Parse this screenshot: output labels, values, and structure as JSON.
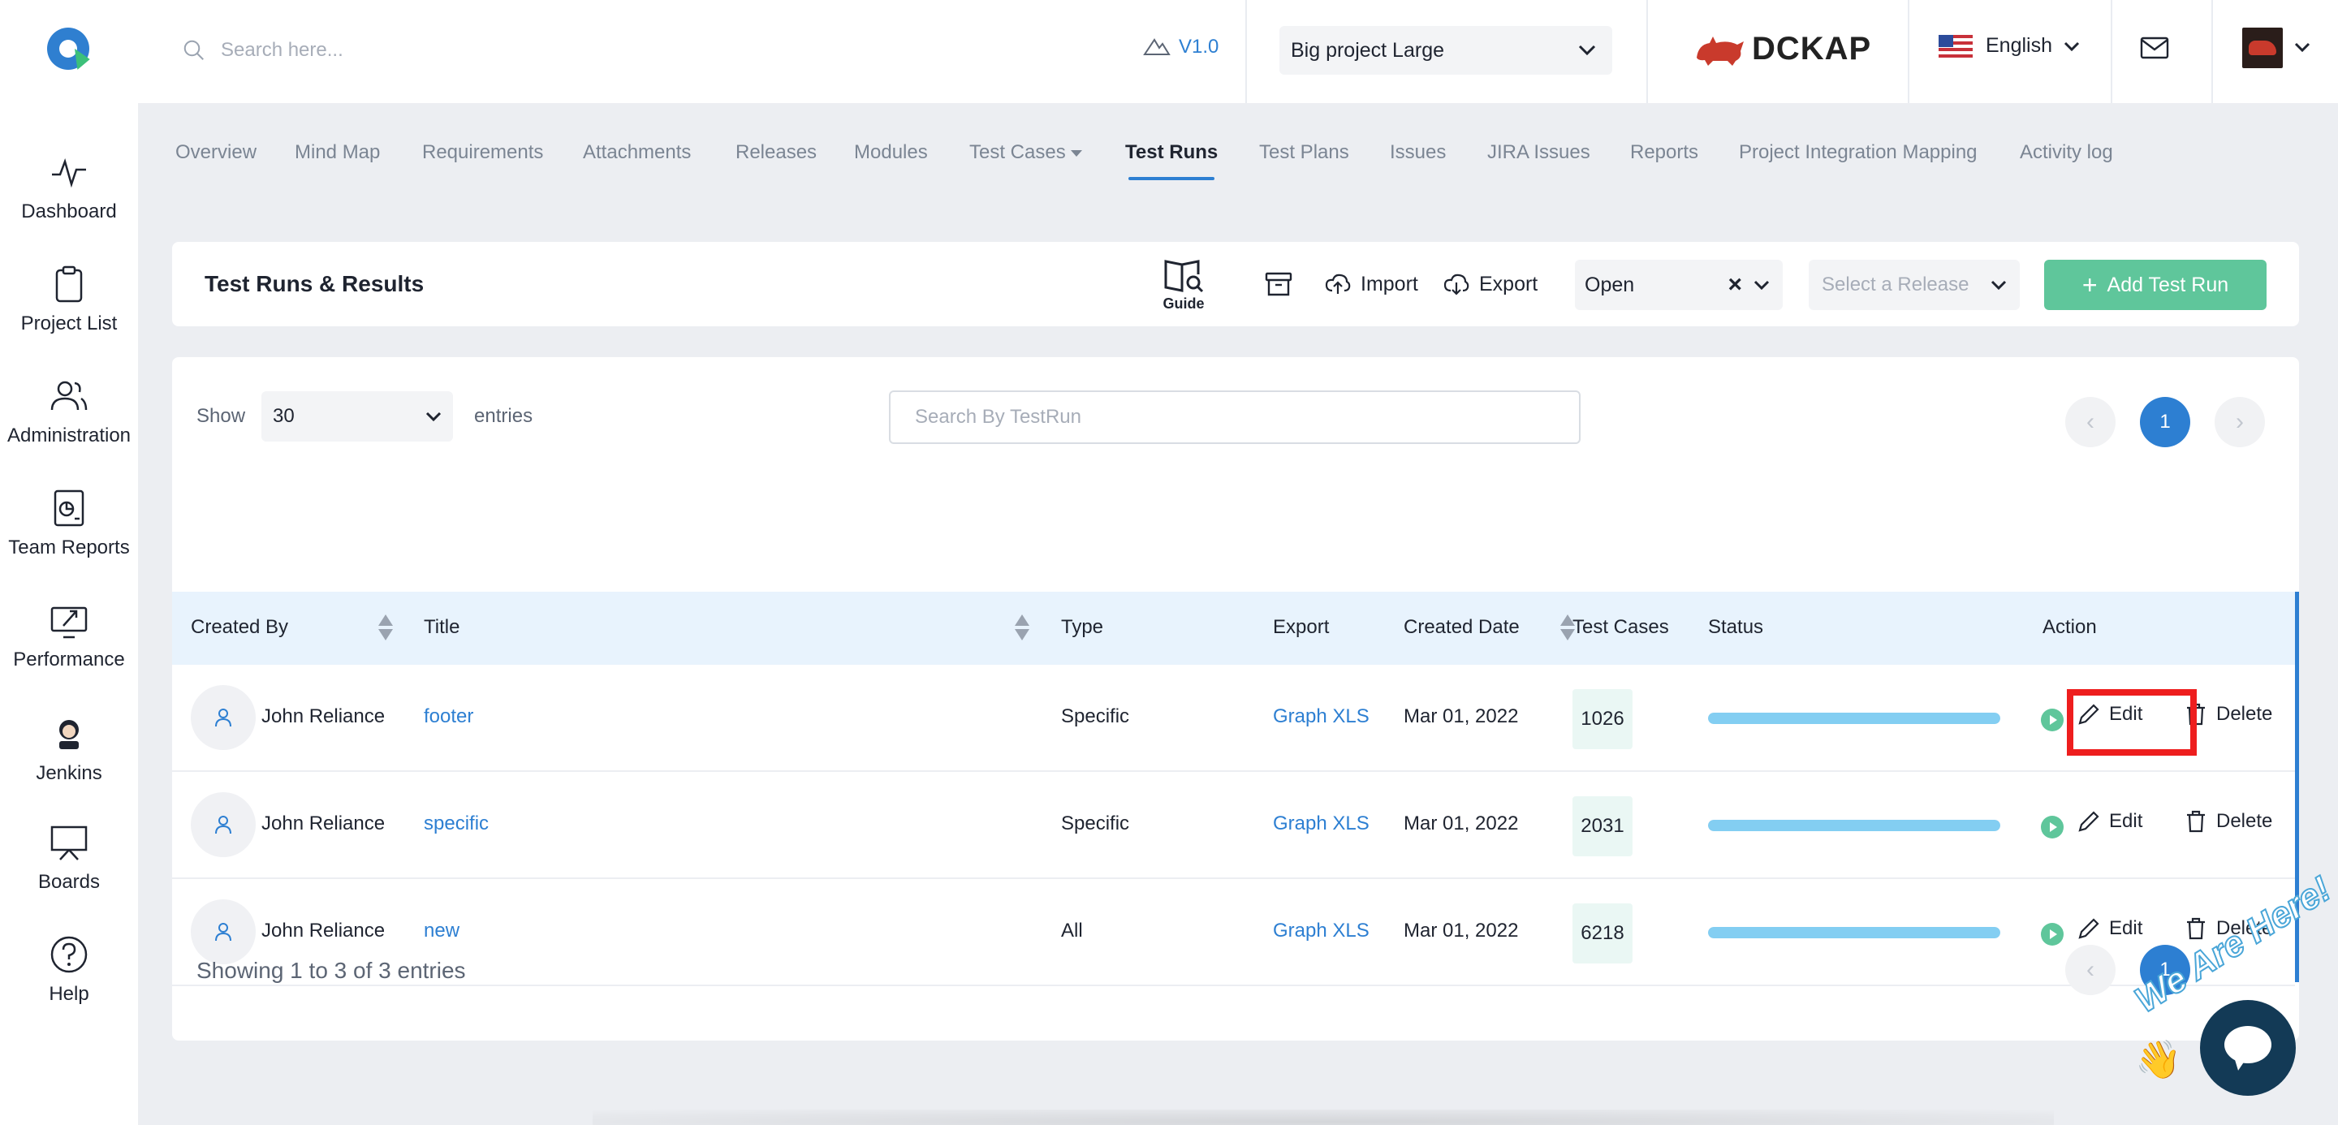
{
  "header": {
    "search_placeholder": "Search here...",
    "version": "V1.0",
    "project": "Big project Large",
    "brand": "DCKAP",
    "language": "English"
  },
  "sidebar": {
    "items": [
      {
        "label": "Dashboard",
        "icon": "pulse-icon"
      },
      {
        "label": "Project List",
        "icon": "clipboard-icon"
      },
      {
        "label": "Administration",
        "icon": "users-icon"
      },
      {
        "label": "Team Reports",
        "icon": "report-icon"
      },
      {
        "label": "Performance",
        "icon": "rocket-icon"
      },
      {
        "label": "Jenkins",
        "icon": "jenkins-icon"
      },
      {
        "label": "Boards",
        "icon": "board-icon"
      },
      {
        "label": "Help",
        "icon": "help-icon"
      }
    ]
  },
  "tabs": [
    "Overview",
    "Mind Map",
    "Requirements",
    "Attachments",
    "Releases",
    "Modules",
    "Test Cases",
    "Test Runs",
    "Test Plans",
    "Issues",
    "JIRA Issues",
    "Reports",
    "Project Integration Mapping",
    "Activity log"
  ],
  "active_tab": "Test Runs",
  "toolbar": {
    "title": "Test Runs & Results",
    "guide": "Guide",
    "import": "Import",
    "export": "Export",
    "status_filter": "Open",
    "release_placeholder": "Select a Release",
    "add_button": "Add Test Run"
  },
  "table_controls": {
    "show_label": "Show",
    "entries_value": "30",
    "entries_label": "entries",
    "search_placeholder": "Search By TestRun",
    "current_page": "1",
    "prev": "‹",
    "next": "›"
  },
  "table": {
    "columns": [
      "Created By",
      "Title",
      "Type",
      "Export",
      "Created Date",
      "Test Cases",
      "Status",
      "Action"
    ],
    "rows": [
      {
        "created_by": "John Reliance",
        "title": "footer",
        "type": "Specific",
        "export": "Graph XLS",
        "date": "Mar 01, 2022",
        "test_cases": "1026",
        "progress": 1.0
      },
      {
        "created_by": "John Reliance",
        "title": "specific",
        "type": "Specific",
        "export": "Graph XLS",
        "date": "Mar 01, 2022",
        "test_cases": "2031",
        "progress": 1.0
      },
      {
        "created_by": "John Reliance",
        "title": "new",
        "type": "All",
        "export": "Graph XLS",
        "date": "Mar 01, 2022",
        "test_cases": "6218",
        "progress": 1.0
      }
    ],
    "edit_label": "Edit",
    "delete_label": "Delete",
    "footer": "Showing 1 to 3 of 3 entries"
  },
  "chat_widget": {
    "text": "We Are Here!"
  },
  "colors": {
    "accent": "#2d7fd2",
    "add_button": "#5fc69b",
    "progress": "#83cef2",
    "highlight": "#ee1e1e"
  }
}
